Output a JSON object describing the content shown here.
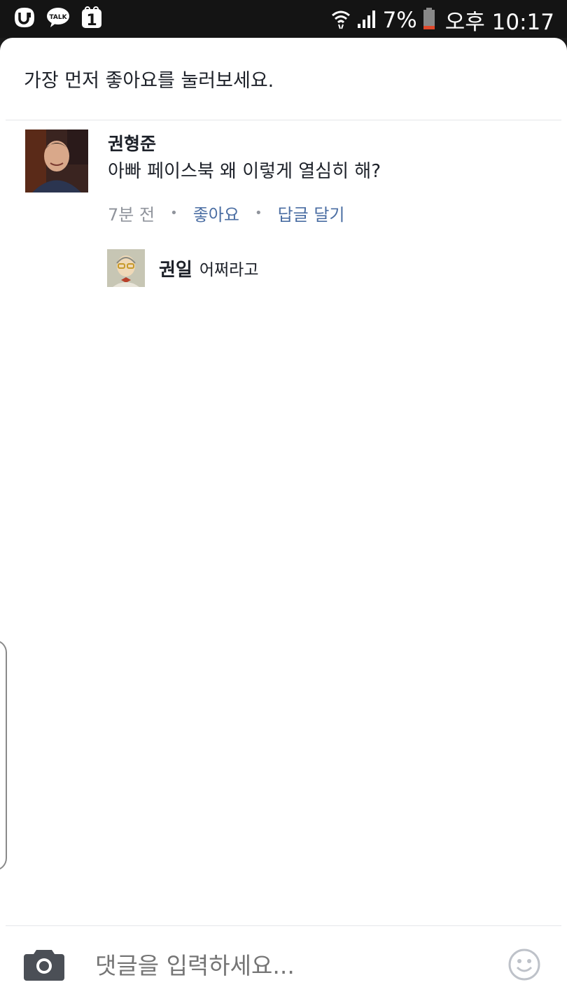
{
  "status_bar": {
    "apps": [
      "u-plus-icon",
      "kakaotalk-icon",
      "notification-1-icon"
    ],
    "talk_label": "TALK",
    "badge_label": "1",
    "battery_percent": "7%",
    "time": "오후 10:17"
  },
  "sheet": {
    "header": "가장 먼저 좋아요를 눌러보세요."
  },
  "comment": {
    "author": "권형준",
    "text": "아빠 페이스북 왜 이렇게 열심히 해?",
    "time": "7분 전",
    "like_label": "좋아요",
    "reply_label": "답글 달기"
  },
  "reply": {
    "author": "권일",
    "text": "어쩌라고"
  },
  "composer": {
    "placeholder": "댓글을 입력하세요..."
  },
  "colors": {
    "link": "#4b6ea3",
    "muted": "#90949c",
    "text": "#1d2129"
  }
}
